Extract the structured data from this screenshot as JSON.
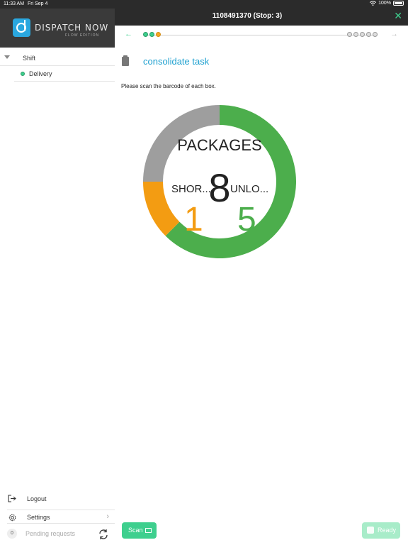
{
  "status_bar": {
    "time": "11:33 AM",
    "date": "Fri Sep 4",
    "battery": "100%"
  },
  "brand": {
    "name": "DISPATCH NOW",
    "subtitle": "FLOW EDITION"
  },
  "header": {
    "title": "1108491370 (Stop: 3)"
  },
  "progress": {
    "left_dots": [
      "done",
      "done",
      "current"
    ],
    "right_dots": [
      "pending",
      "pending",
      "pending",
      "pending",
      "pending"
    ]
  },
  "sidebar": {
    "shift_label": "Shift",
    "delivery_label": "Delivery",
    "logout_label": "Logout",
    "settings_label": "Settings",
    "pending_count": "0",
    "pending_label": "Pending requests"
  },
  "task": {
    "title": "consolidate task",
    "instruction": "Please scan the barcode of each box."
  },
  "packages": {
    "title": "PACKAGES",
    "total": "8",
    "short_label": "SHOR...",
    "short_value": "1",
    "unloaded_label": "UNLO...",
    "unloaded_value": "5",
    "segments": [
      {
        "name": "unloaded",
        "value": 5,
        "color": "#4cae4c"
      },
      {
        "name": "short",
        "value": 1,
        "color": "#f39c12"
      },
      {
        "name": "remaining",
        "value": 2,
        "color": "#9e9e9e"
      }
    ]
  },
  "buttons": {
    "scan_label": "Scan",
    "ready_label": "Ready"
  },
  "colors": {
    "accent": "#3ecf8e",
    "link": "#1b9fcf",
    "header_bg": "#2b2b2b"
  }
}
